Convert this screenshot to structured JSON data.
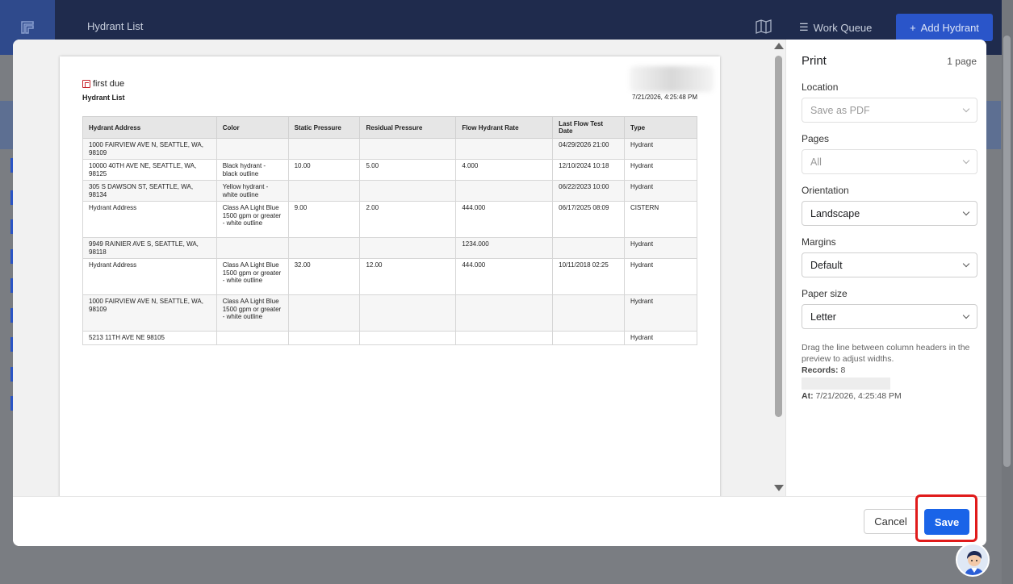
{
  "app": {
    "title": "Hydrant List",
    "work_queue_label": "Work Queue",
    "add_hydrant_label": "Add Hydrant"
  },
  "document": {
    "logo_text": "first due",
    "title": "Hydrant List",
    "date": "7/21/2026, 4:25:48 PM",
    "columns": [
      "Hydrant Address",
      "Color",
      "Static Pressure",
      "Residual Pressure",
      "Flow Hydrant Rate",
      "Last Flow Test Date",
      "Type"
    ],
    "rows": [
      [
        "1000 FAIRVIEW AVE N, SEATTLE, WA, 98109",
        "",
        "",
        "",
        "",
        "04/29/2026 21:00",
        "Hydrant"
      ],
      [
        "10000 40TH AVE NE, SEATTLE, WA, 98125",
        "Black hydrant - black outline",
        "10.00",
        "5.00",
        "4.000",
        "12/10/2024 10:18",
        "Hydrant"
      ],
      [
        "305 S DAWSON ST, SEATTLE, WA, 98134",
        "Yellow hydrant - white outline",
        "",
        "",
        "",
        "06/22/2023 10:00",
        "Hydrant"
      ],
      [
        "Hydrant Address",
        "Class AA Light Blue 1500 gpm or greater - white outline",
        "9.00",
        "2.00",
        "444.000",
        "06/17/2025 08:09",
        "CISTERN"
      ],
      [
        "9949 RAINIER AVE S, SEATTLE, WA, 98118",
        "",
        "",
        "",
        "1234.000",
        "",
        "Hydrant"
      ],
      [
        "Hydrant Address",
        "Class AA Light Blue 1500 gpm or greater - white outline",
        "32.00",
        "12.00",
        "444.000",
        "10/11/2018 02:25",
        "Hydrant"
      ],
      [
        "1000 FAIRVIEW AVE N, SEATTLE, WA, 98109",
        "Class AA Light Blue 1500 gpm or greater - white outline",
        "",
        "",
        "",
        "",
        "Hydrant"
      ],
      [
        "5213 11TH AVE NE 98105",
        "",
        "",
        "",
        "",
        "",
        "Hydrant"
      ]
    ]
  },
  "print_panel": {
    "title": "Print",
    "page_count": "1 page",
    "location_label": "Location",
    "location_value": "Save as PDF",
    "pages_label": "Pages",
    "pages_value": "All",
    "orientation_label": "Orientation",
    "orientation_value": "Landscape",
    "margins_label": "Margins",
    "margins_value": "Default",
    "paper_size_label": "Paper size",
    "paper_size_value": "Letter",
    "hint": "Drag the line between column headers in the preview to adjust widths.",
    "records_label": "Records:",
    "records_value": "8",
    "at_label": "At:",
    "at_value": "7/21/2026, 4:25:48 PM"
  },
  "footer": {
    "cancel_label": "Cancel",
    "save_label": "Save"
  },
  "colors": {
    "primary": "#1a64e8",
    "highlight": "#e01b1b",
    "header_bg": "#1f2b4d"
  }
}
